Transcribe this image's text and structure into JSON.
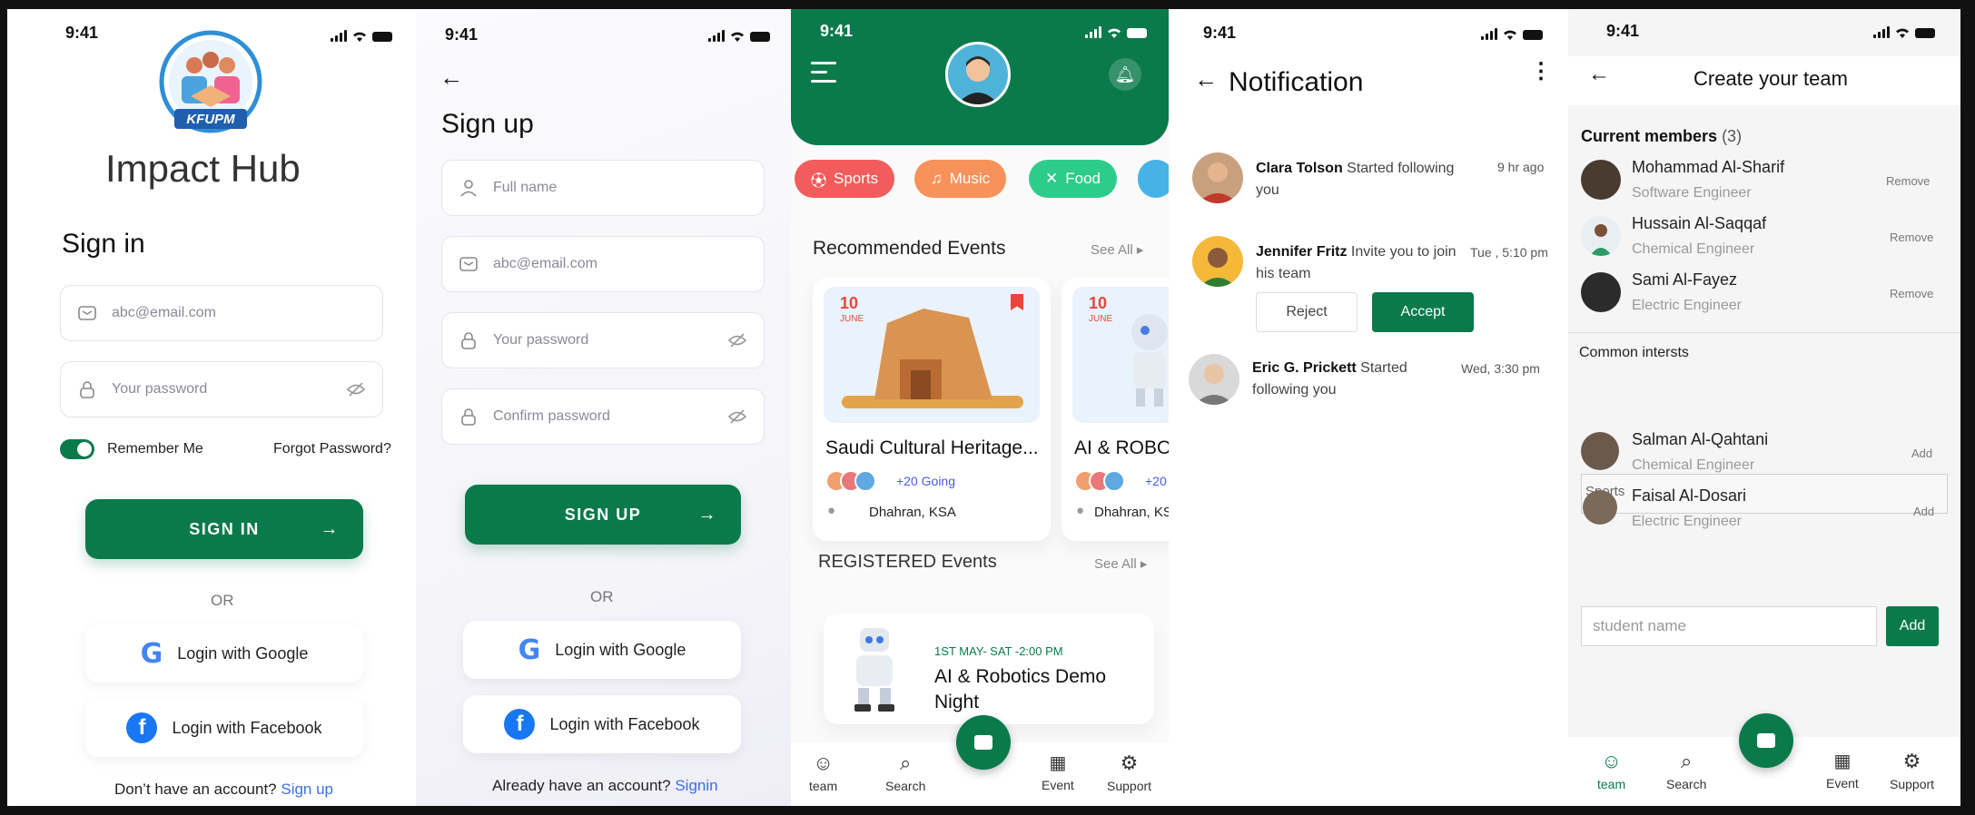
{
  "status_time": "9:41",
  "signin": {
    "brand_badge": "KFUPM",
    "app_title": "Impact Hub",
    "heading": "Sign in",
    "email_placeholder": "abc@email.com",
    "password_placeholder": "Your password",
    "remember_label": "Remember Me",
    "forgot_label": "Forgot Password?",
    "signin_button": "SIGN IN",
    "or_label": "OR",
    "google_label": "Login with Google",
    "facebook_label": "Login with Facebook",
    "footer_text": "Don’t have an account?",
    "footer_link": "Sign up"
  },
  "signup": {
    "heading": "Sign up",
    "fullname_placeholder": "Full name",
    "email_placeholder": "abc@email.com",
    "password_placeholder": "Your password",
    "confirm_placeholder": "Confirm password",
    "signup_button": "SIGN UP",
    "or_label": "OR",
    "google_label": "Login with Google",
    "facebook_label": "Login with Facebook",
    "footer_text": "Already have an account?",
    "footer_link": "Signin"
  },
  "home": {
    "categories": [
      {
        "label": "Sports",
        "icon": "basketball-icon",
        "color": "#f25c5c"
      },
      {
        "label": "Music",
        "icon": "music-icon",
        "color": "#f7925a"
      },
      {
        "label": "Food",
        "icon": "fork-knife-icon",
        "color": "#2ecc8b"
      }
    ],
    "recommended_title": "Recommended Events",
    "see_all": "See All ▸",
    "events": [
      {
        "day": "10",
        "month": "JUNE",
        "title": "Saudi Cultural Heritage...",
        "going": "+20 Going",
        "location": "Dhahran, KSA"
      },
      {
        "day": "10",
        "month": "JUNE",
        "title": "AI & ROBO",
        "going": "+20",
        "location": "Dhahran, KS"
      }
    ],
    "registered_title": "REGISTERED Events",
    "registered_see_all": "See All ▸",
    "registered_event": {
      "date": "1ST MAY- SAT -2:00 PM",
      "title": "AI & Robotics Demo Night"
    },
    "nav": [
      "team",
      "Search",
      "Event",
      "Support"
    ]
  },
  "notifications": {
    "title": "Notification",
    "items": [
      {
        "name": "Clara Tolson",
        "text": " Started following you",
        "time": "9 hr ago"
      },
      {
        "name": "Jennifer Fritz",
        "text": " Invite you to join his team",
        "time": "Tue , 5:10 pm"
      },
      {
        "name": "Eric G. Prickett",
        "text": " Started following you",
        "time": "Wed, 3:30 pm"
      }
    ],
    "reject_label": "Reject",
    "accept_label": "Accept"
  },
  "team": {
    "title": "Create your team",
    "current_label": "Current members",
    "current_count": "(3)",
    "members": [
      {
        "name": "Mohammad Al-Sharif",
        "role": "Software Engineer",
        "action": "Remove"
      },
      {
        "name": "Hussain Al-Saqqaf",
        "role": "Chemical Engineer",
        "action": "Remove"
      },
      {
        "name": "Sami Al-Fayez",
        "role": "Electric Engineer",
        "action": "Remove"
      }
    ],
    "common_label": "Common intersts",
    "overlay_label": "Sports",
    "suggestions": [
      {
        "name": "Salman Al-Qahtani",
        "role": "Chemical Engineer",
        "action": "Add"
      },
      {
        "name": "Faisal Al-Dosari",
        "role": "Electric Engineer",
        "action": "Add"
      }
    ],
    "input_placeholder": "student name",
    "add_button": "Add",
    "nav": [
      "team",
      "Search",
      "Event",
      "Support"
    ]
  },
  "colors": {
    "primary": "#0a7a4b",
    "link": "#3b6fe0",
    "event_date": "#e8453c"
  }
}
